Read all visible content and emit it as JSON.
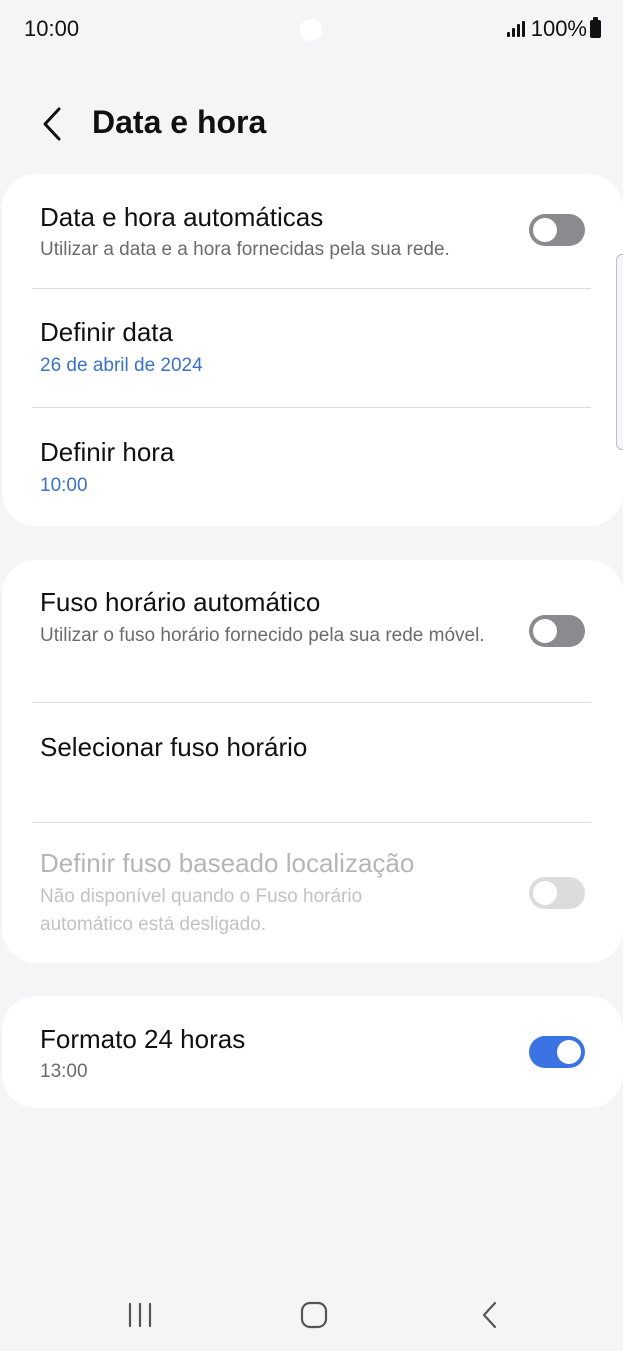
{
  "status_bar": {
    "time": "10:00",
    "battery": "100%"
  },
  "header": {
    "title": "Data e hora"
  },
  "card1": {
    "auto_datetime": {
      "title": "Data e hora automáticas",
      "subtitle": "Utilizar a data e a hora fornecidas pela sua rede.",
      "toggle": "off"
    },
    "set_date": {
      "title": "Definir data",
      "value": "26 de abril de 2024"
    },
    "set_time": {
      "title": "Definir hora",
      "value": "10:00"
    }
  },
  "card2": {
    "auto_timezone": {
      "title": "Fuso horário automático",
      "subtitle": "Utilizar o fuso horário fornecido pela sua rede móvel.",
      "toggle": "off"
    },
    "select_timezone": {
      "title": "Selecionar fuso horário"
    },
    "location_timezone": {
      "title": "Definir fuso baseado localização",
      "subtitle": "Não disponível quando o Fuso horário automático está desligado.",
      "toggle": "disabled"
    }
  },
  "card3": {
    "format_24h": {
      "title": "Formato 24 horas",
      "value": "13:00",
      "toggle": "on"
    }
  },
  "colors": {
    "accent": "#3c73e3",
    "link_blue": "#3a72c4",
    "background": "#f5f5f7",
    "card": "#ffffff"
  },
  "icons": {
    "back": "chevron-left-icon",
    "signal": "signal-bars-icon",
    "battery": "battery-icon",
    "nav_recent": "recent-apps-icon",
    "nav_home": "home-icon",
    "nav_back": "back-arrow-icon"
  }
}
